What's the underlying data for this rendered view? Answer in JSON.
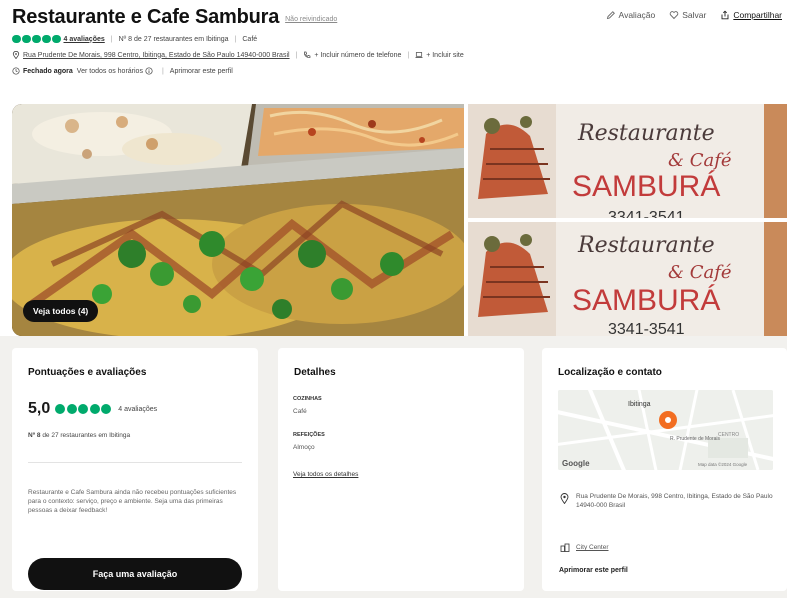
{
  "header": {
    "title": "Restaurante e Cafe Sambura",
    "claim_status": "Não reivindicado",
    "actions": {
      "review": "Avaliação",
      "save": "Salvar",
      "share": "Compartilhar"
    },
    "rating_count": "4 avaliações",
    "rank": "Nº 8 de 27 restaurantes em Ibitinga",
    "cuisine": "Café",
    "address": "Rua Prudente De Morais, 998 Centro, Ibitinga, Estado de São Paulo 14940-000 Brasil",
    "add_phone": "+ Incluir número de telefone",
    "add_site": "+ Incluir site",
    "status": "Fechado agora",
    "hours_link": "Ver todos os horários",
    "improve_link": "Aprimorar este perfil"
  },
  "gallery": {
    "see_all_label": "Veja todos (4)",
    "sign_line1": "Restaurante",
    "sign_line2": "& Café",
    "sign_line3": "SAMBURÁ",
    "sign_phone": "3341-3541"
  },
  "ratings_card": {
    "title": "Pontuações e avaliações",
    "score": "5,0",
    "count": "4 avaliações",
    "rank_bold": "Nº 8",
    "rank_rest": "de 27 restaurantes em Ibitinga",
    "note": "Restaurante e Cafe Sambura ainda não recebeu pontuações suficientes para o contexto: serviço, preço e ambiente. Seja uma das primeiras pessoas a deixar feedback!",
    "button": "Faça uma avaliação"
  },
  "details_card": {
    "title": "Detalhes",
    "cuisine_label": "COZINHAS",
    "cuisine_value": "Café",
    "meals_label": "REFEIÇÕES",
    "meals_value": "Almoço",
    "all_details": "Veja todos os detalhes"
  },
  "location_card": {
    "title": "Localização e contato",
    "map_city": "Ibitinga",
    "map_street": "R. Prudente de Morais",
    "map_district": "CENTRO",
    "map_provider": "Google",
    "map_attribution": "Map data ©2024 Google",
    "address": "Rua Prudente De Morais, 998 Centro, Ibitinga, Estado de São Paulo 14940-000 Brasil",
    "neighborhood": "City Center",
    "improve": "Aprimorar este perfil"
  },
  "colors": {
    "rating_green": "#00aa6c",
    "button_black": "#111111",
    "map_pin": "#f26d21",
    "cards_background": "#f2f1ee"
  },
  "icons": [
    "pencil-icon",
    "heart-icon",
    "share-icon",
    "map-pin-icon",
    "phone-icon",
    "laptop-icon",
    "clock-icon",
    "info-icon",
    "neighborhood-icon"
  ]
}
